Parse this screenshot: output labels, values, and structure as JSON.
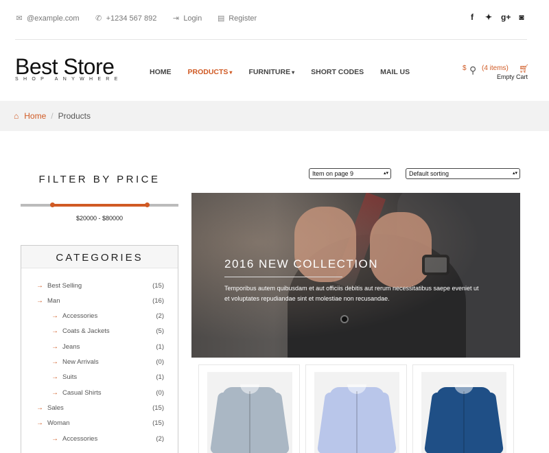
{
  "topbar": {
    "email": "@example.com",
    "phone": "+1234 567 892",
    "login": "Login",
    "register": "Register",
    "social_icons": [
      "facebook-icon",
      "twitter-icon",
      "google-plus-icon",
      "instagram-icon"
    ]
  },
  "logo": {
    "name": "Best Store",
    "tagline": "SHOP ANYWHERE"
  },
  "nav": {
    "home": "HOME",
    "products": "PRODUCTS",
    "furniture": "FURNITURE",
    "short_codes": "SHORT CODES",
    "mail_us": "MAIL US"
  },
  "cart": {
    "items": "(4 items)",
    "empty": "Empty Cart",
    "currency": "$"
  },
  "breadcrumb": {
    "home": "Home",
    "current": "Products"
  },
  "filter": {
    "title": "FILTER BY PRICE",
    "range": "$20000 - $80000",
    "min_fraction": 0.2,
    "max_fraction": 0.8
  },
  "categories": {
    "title": "CATEGORIES",
    "items": [
      {
        "label": "Best Selling",
        "count": "(15)",
        "level": 0
      },
      {
        "label": "Man",
        "count": "(16)",
        "level": 0
      },
      {
        "label": "Accessories",
        "count": "(2)",
        "level": 1
      },
      {
        "label": "Coats & Jackets",
        "count": "(5)",
        "level": 1
      },
      {
        "label": "Jeans",
        "count": "(1)",
        "level": 1
      },
      {
        "label": "New Arrivals",
        "count": "(0)",
        "level": 1
      },
      {
        "label": "Suits",
        "count": "(1)",
        "level": 1
      },
      {
        "label": "Casual Shirts",
        "count": "(0)",
        "level": 1
      },
      {
        "label": "Sales",
        "count": "(15)",
        "level": 0
      },
      {
        "label": "Woman",
        "count": "(15)",
        "level": 0
      },
      {
        "label": "Accessories",
        "count": "(2)",
        "level": 1
      }
    ]
  },
  "controls": {
    "per_page": "Item on page 9",
    "sorting": "Default sorting"
  },
  "banner": {
    "title": "2016 NEW COLLECTION",
    "text": "Temporibus autem quibusdam et aut officiis debitis aut rerum necessitatibus saepe eveniet ut et voluptates repudiandae sint et molestiae non recusandae."
  },
  "products": [
    {
      "name": "product-grey-shirt",
      "color": "#aab7c4"
    },
    {
      "name": "product-light-blue-shirt",
      "color": "#b9c6ea"
    },
    {
      "name": "product-navy-shirt",
      "color": "#1f4f86"
    }
  ],
  "colors": {
    "accent": "#d05a24"
  }
}
